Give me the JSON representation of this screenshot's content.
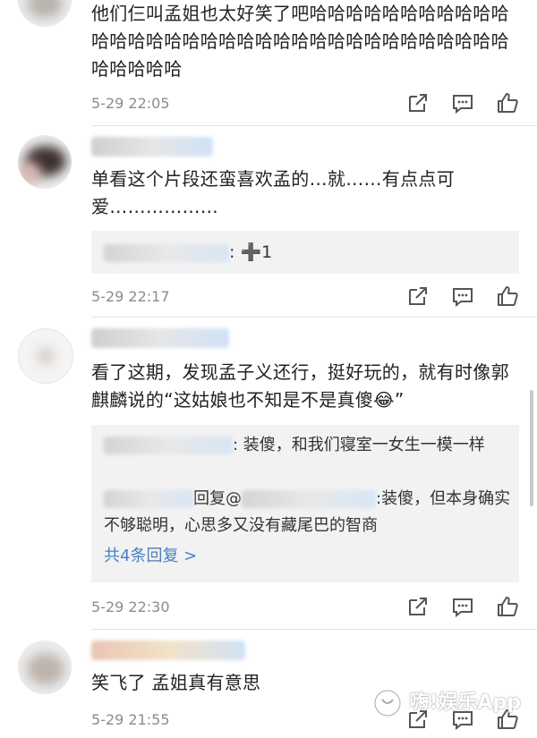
{
  "comments": [
    {
      "text": "他们仨叫孟姐也太好笑了吧哈哈哈哈哈哈哈哈哈哈哈哈哈哈哈哈哈哈哈哈哈哈哈哈哈哈哈哈哈哈哈哈哈哈哈哈哈哈哈",
      "time": "5-29 22:05"
    },
    {
      "text": "单看这个片段还蛮喜欢孟的…就……有点点可爱………………",
      "reply_suffix": ": ➕1",
      "time": "5-29 22:17"
    },
    {
      "text": "看了这期，发现孟子义还行，挺好玩的，就有时像郭麒麟说的“这姑娘也不知是不是真傻😂”",
      "reply1_text": ": 装傻，和我们寝室一女生一模一样",
      "reply2_prefix": "回复@",
      "reply2_text": ":装傻，但本身确实不够聪明，心思多又没有藏尾巴的智商",
      "more_replies": "共4条回复 >",
      "time": "5-29 22:30"
    },
    {
      "text": "笑飞了 孟姐真有意思",
      "time": "5-29 21:55"
    }
  ],
  "watermark": "嗨!娱乐App",
  "icons": [
    "share-icon",
    "comment-icon",
    "like-icon"
  ],
  "colors": {
    "link": "#4a7fc1",
    "meta": "#8c8c8c",
    "reply_bg": "#f2f2f2"
  }
}
